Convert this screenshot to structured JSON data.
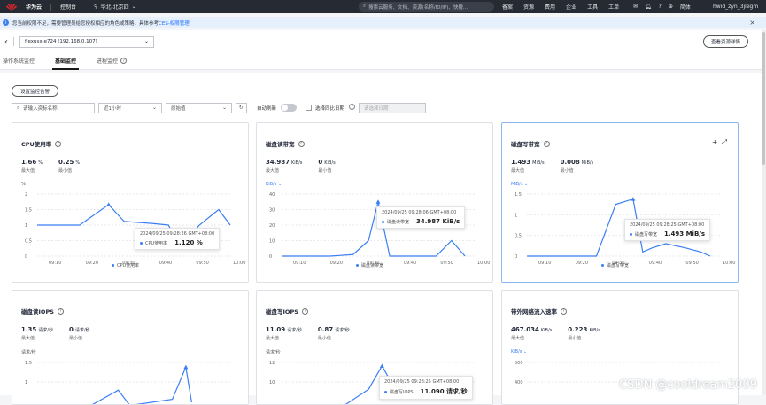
{
  "topbar": {
    "brand": "华为云",
    "console": "控制台",
    "region": "华北-北京四",
    "search_placeholder": "搜索云服务、文档、资源(名称/ID/IP)、快捷...",
    "navs": [
      "备案",
      "资源",
      "费用",
      "企业",
      "工具",
      "工单"
    ],
    "lang": "简体",
    "user": "hwid_zyn_3jlegm"
  },
  "notice": {
    "text": "您当前权限不足，需要管理员给您授权相应的角色或策略，具体参考",
    "link": "CES-权限管理"
  },
  "header": {
    "instance": "flexusx-e724 (192.168.0.107)",
    "view_button": "查看资源详情"
  },
  "tabs": [
    {
      "label": "操作系统监控"
    },
    {
      "label": "基础监控"
    },
    {
      "label": "进程监控"
    }
  ],
  "toolbar": {
    "set_alarm": "设置监控告警",
    "search_placeholder": "请输入资标名称",
    "time_range": "近1小时",
    "agg": "原始值",
    "auto_refresh": "自动刷新",
    "compare": "选择同比日期",
    "date_placeholder": "请选择日期"
  },
  "cards": [
    {
      "title": "CPU使用率",
      "max_val": "1.66",
      "max_unit": "%",
      "max_label": "最大值",
      "min_val": "0.25",
      "min_unit": "%",
      "min_label": "最小值",
      "axis_unit": "%",
      "legend": "CPU使用率",
      "chart_data": {
        "type": "line",
        "x": [
          "09:10",
          "09:20",
          "09:30",
          "09:40",
          "09:50",
          "10:00"
        ],
        "y_ticks": [
          "2",
          "1.5",
          "1",
          "0.5",
          "0"
        ],
        "ylim": [
          0,
          2
        ],
        "points": [
          [
            0,
            1
          ],
          [
            0.12,
            1
          ],
          [
            0.22,
            1
          ],
          [
            0.37,
            1.66
          ],
          [
            0.45,
            1.12
          ],
          [
            0.6,
            1.05
          ],
          [
            0.68,
            1
          ],
          [
            0.74,
            0.25
          ],
          [
            0.84,
            1
          ],
          [
            0.94,
            1.5
          ],
          [
            1,
            1
          ]
        ]
      },
      "tooltip": {
        "time": "2024/09/25 09:28:26 GMT+08:00",
        "series": "CPU使用率",
        "value": "1.120 %"
      }
    },
    {
      "title": "磁盘读带宽",
      "max_val": "34.987",
      "max_unit": "KiB/s",
      "max_label": "最大值",
      "min_val": "0",
      "min_unit": "KiB/s",
      "min_label": "最小值",
      "axis_unit": "KiB/s",
      "legend": "磁盘读带宽",
      "chart_data": {
        "type": "line",
        "x": [
          "09:10",
          "09:20",
          "09:30",
          "09:40",
          "09:50",
          "10:00"
        ],
        "y_ticks": [
          "40",
          "30",
          "20",
          "10",
          "0"
        ],
        "ylim": [
          0,
          40
        ],
        "points": [
          [
            0,
            0
          ],
          [
            0.12,
            0
          ],
          [
            0.25,
            0
          ],
          [
            0.37,
            1
          ],
          [
            0.45,
            10
          ],
          [
            0.5,
            35
          ],
          [
            0.56,
            0
          ],
          [
            0.8,
            0
          ],
          [
            0.88,
            10
          ],
          [
            0.95,
            0
          ]
        ]
      },
      "tooltip": {
        "time": "2024/09/25 09:28:06 GMT+08:00",
        "series": "磁盘读带宽",
        "value": "34.987 KiB/s"
      }
    },
    {
      "title": "磁盘写带宽",
      "max_val": "1.493",
      "max_unit": "MiB/s",
      "max_label": "最大值",
      "min_val": "0.008",
      "min_unit": "MiB/s",
      "min_label": "最小值",
      "axis_unit": "MiB/s",
      "legend": "磁盘写带宽",
      "chart_data": {
        "type": "line",
        "x": [
          "09:10",
          "09:20",
          "09:30",
          "09:40",
          "09:50",
          "10:00"
        ],
        "y_ticks": [
          "1.5",
          "1",
          "0.5",
          "0"
        ],
        "ylim": [
          0,
          1.5
        ],
        "points": [
          [
            0,
            0
          ],
          [
            0.25,
            0
          ],
          [
            0.36,
            0
          ],
          [
            0.46,
            1.25
          ],
          [
            0.55,
            1.38
          ],
          [
            0.6,
            0.1
          ],
          [
            0.65,
            0.2
          ],
          [
            0.72,
            0.3
          ],
          [
            0.82,
            0.2
          ],
          [
            0.9,
            0.1
          ],
          [
            0.95,
            0
          ]
        ]
      },
      "tooltip": {
        "time": "2024/09/25 09:28:25 GMT+08:00",
        "series": "磁盘写带宽",
        "value": "1.493 MiB/s"
      }
    },
    {
      "title": "磁盘读IOPS",
      "max_val": "1.35",
      "max_unit": "请求/秒",
      "max_label": "最大值",
      "min_val": "0",
      "min_unit": "请求/秒",
      "min_label": "最小值",
      "axis_unit": "请求/秒",
      "chart_data": {
        "type": "line",
        "y_ticks": [
          "1.5",
          "1"
        ],
        "ylim": [
          0,
          1.5
        ],
        "points": [
          [
            0,
            0
          ],
          [
            0.25,
            0
          ],
          [
            0.42,
            0.6
          ],
          [
            0.48,
            0.1
          ],
          [
            0.7,
            0.3
          ],
          [
            0.77,
            1.35
          ],
          [
            0.8,
            0.2
          ]
        ]
      }
    },
    {
      "title": "磁盘写IOPS",
      "max_val": "11.09",
      "max_unit": "请求/秒",
      "max_label": "最大值",
      "min_val": "0.87",
      "min_unit": "请求/秒",
      "min_label": "最小值",
      "axis_unit": "请求/秒",
      "chart_data": {
        "type": "line",
        "y_ticks": [
          "12",
          "10"
        ],
        "ylim": [
          0,
          12
        ],
        "points": [
          [
            0,
            0
          ],
          [
            0.3,
            0
          ],
          [
            0.45,
            5
          ],
          [
            0.52,
            11.09
          ],
          [
            0.6,
            4
          ]
        ]
      },
      "tooltip": {
        "time": "2024/09/25 09:28:25 GMT+08:00",
        "series": "磁盘写IOPS",
        "value": "11.090 请求/秒"
      }
    },
    {
      "title": "带外网络流入速率",
      "max_val": "467.034",
      "max_unit": "KiB/s",
      "max_label": "最大值",
      "min_val": "0.223",
      "min_unit": "KiB/s",
      "min_label": "最小值",
      "axis_unit": "KiB/s",
      "chart_data": {
        "type": "line",
        "y_ticks": [
          "500",
          "400"
        ],
        "ylim": [
          0,
          500
        ],
        "points": []
      }
    }
  ],
  "watermark": "CSDN @cooldream2009"
}
